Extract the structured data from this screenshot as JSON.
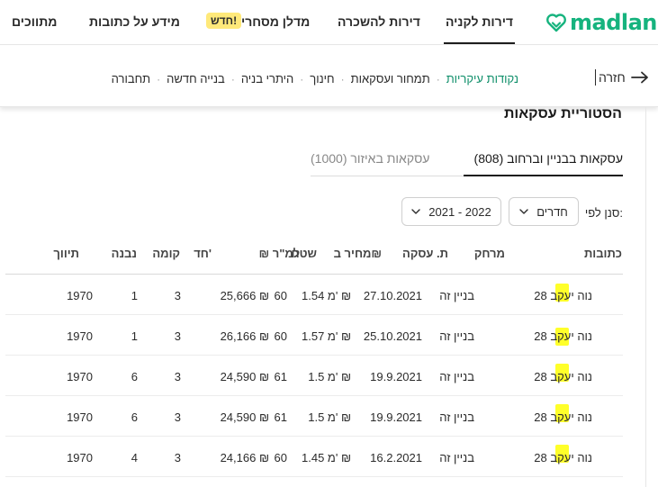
{
  "brand": {
    "name": "madlan",
    "color": "#16b37e"
  },
  "top_nav": {
    "items": [
      {
        "label": "דירות לקניה",
        "active": true
      },
      {
        "label": "דירות להשכרה",
        "active": false
      },
      {
        "label": "מדלן מסחרי",
        "active": false
      },
      {
        "label": "מידע על כתובות",
        "active": false
      },
      {
        "label": "מתווכים",
        "active": false
      }
    ],
    "badge": "חדש!"
  },
  "sub_nav": {
    "back_label": "חזרה",
    "back_icon": "arrow-right-icon",
    "tabs": [
      {
        "label": "נקודות עיקריות",
        "active": true
      },
      {
        "label": "תמחור ועסקאות",
        "active": false
      },
      {
        "label": "חינוך",
        "active": false
      },
      {
        "label": "היתרי בניה",
        "active": false
      },
      {
        "label": "בנייה חדשה",
        "active": false
      },
      {
        "label": "תחבורה",
        "active": false
      }
    ],
    "separator": "·"
  },
  "section": {
    "title": "הסטוריית עסקאות",
    "tabs": [
      {
        "label": "עסקאות בבניין וברחוב (808)",
        "active": true
      },
      {
        "label": "עסקאות באיזור (1000)",
        "active": false
      }
    ]
  },
  "filters": {
    "label": "סנן לפי:",
    "rooms": "חדרים",
    "years": "2021 - 2022",
    "dropdown_icon": "chevron-down-icon"
  },
  "table": {
    "headers": {
      "address": "כתובות",
      "distance": "מרחק",
      "date": "ת. עסקה",
      "price": "מחיר ב₪",
      "area": "שטח",
      "ppm": "₪ למ\"ר",
      "rooms": "חד'",
      "floor": "קומה",
      "height": "נבנה",
      "renovation": "תיווך"
    },
    "rows": [
      {
        "address": "נוה יעקב 28",
        "distance": "בניין זה",
        "date": "27.10.2021",
        "price": "1.54 מ' ₪",
        "area": "60",
        "ppm": "25,666 ₪",
        "rooms": "3",
        "floor": "1",
        "height": "1970"
      },
      {
        "address": "נוה יעקב 28",
        "distance": "בניין זה",
        "date": "25.10.2021",
        "price": "1.57 מ' ₪",
        "area": "60",
        "ppm": "26,166 ₪",
        "rooms": "3",
        "floor": "1",
        "height": "1970"
      },
      {
        "address": "נוה יעקב 28",
        "distance": "בניין זה",
        "date": "19.9.2021",
        "price": "1.5 מ' ₪",
        "area": "61",
        "ppm": "24,590 ₪",
        "rooms": "3",
        "floor": "6",
        "height": "1970"
      },
      {
        "address": "נוה יעקב 28",
        "distance": "בניין זה",
        "date": "19.9.2021",
        "price": "1.5 מ' ₪",
        "area": "61",
        "ppm": "24,590 ₪",
        "rooms": "3",
        "floor": "6",
        "height": "1970"
      },
      {
        "address": "נוה יעקב 28",
        "distance": "בניין זה",
        "date": "16.2.2021",
        "price": "1.45 מ' ₪",
        "area": "60",
        "ppm": "24,166 ₪",
        "rooms": "3",
        "floor": "4",
        "height": "1970"
      }
    ]
  }
}
